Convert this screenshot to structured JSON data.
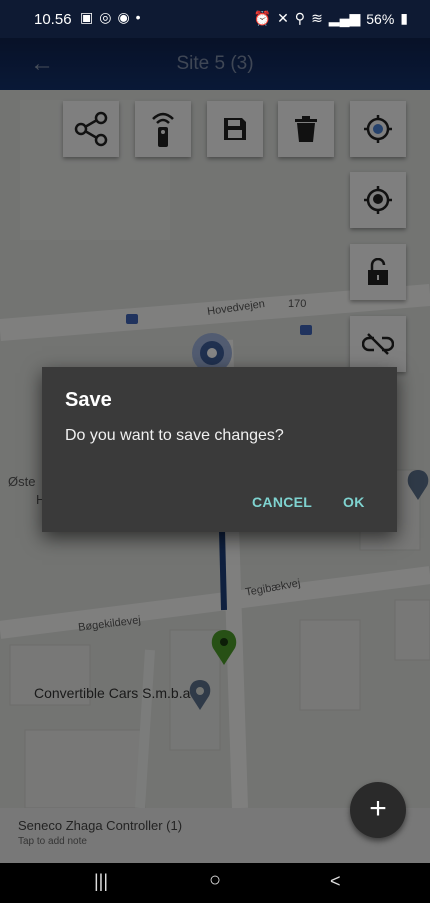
{
  "status_bar": {
    "time": "10.56",
    "battery": "56%",
    "left_icons": [
      "gallery-icon",
      "instagram-icon",
      "record-icon",
      "dot"
    ],
    "right_icons": [
      "alarm-icon",
      "mute-icon",
      "location-icon",
      "wifi-icon",
      "signal-icon",
      "battery-icon"
    ]
  },
  "app_bar": {
    "title": "Site 5 (3)",
    "back_icon": "arrow-left-icon"
  },
  "toolbar": {
    "buttons": [
      {
        "icon": "share-icon"
      },
      {
        "icon": "remote-icon"
      },
      {
        "icon": "save-icon"
      },
      {
        "icon": "delete-icon"
      },
      {
        "icon": "locate-target-icon"
      }
    ],
    "side_buttons": [
      {
        "icon": "gps-pin-icon"
      },
      {
        "icon": "unlock-icon"
      },
      {
        "icon": "unlink-icon"
      }
    ]
  },
  "map": {
    "street_labels": [
      "Hovedvejen",
      "170",
      "Tegibækvej",
      "Bøgekildevej",
      "Øste",
      "H"
    ],
    "poi": "Convertible Cars S.m.b.a",
    "colors": {
      "route": "#1d3e7a",
      "pin_green": "#4c9a2a",
      "pin_blue": "#3f5f9a"
    }
  },
  "dialog": {
    "title": "Save",
    "message": "Do you want to save changes?",
    "cancel_label": "CANCEL",
    "ok_label": "OK"
  },
  "bottom_sheet": {
    "device_name": "Seneco Zhaga Controller (1)",
    "note_hint": "Tap to add note"
  },
  "fab": {
    "label": "+"
  },
  "nav_bar": {
    "recent": "|||",
    "home": "○",
    "back": "<"
  }
}
